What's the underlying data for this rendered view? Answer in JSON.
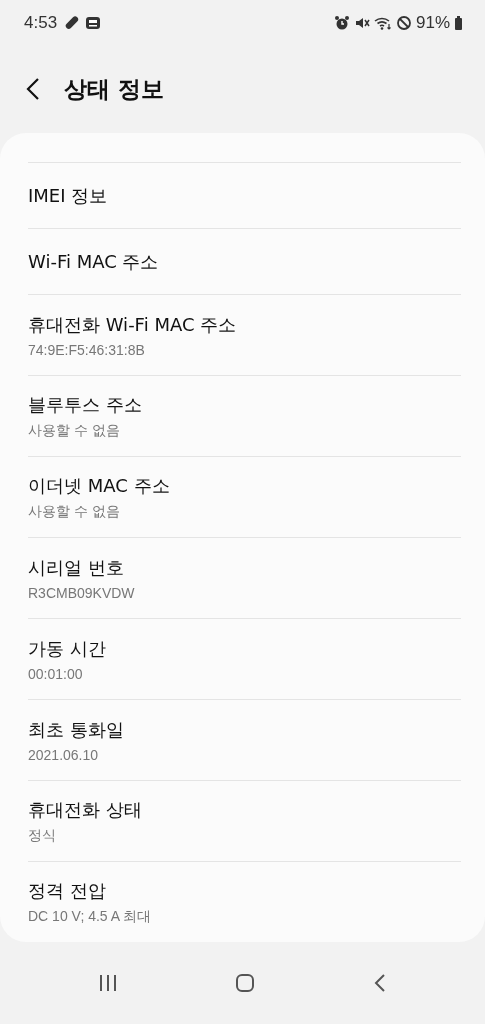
{
  "status_bar": {
    "time": "4:53",
    "battery": "91%"
  },
  "header": {
    "title": "상태 정보"
  },
  "items": [
    {
      "title": "IMEI 정보"
    },
    {
      "title": "Wi-Fi MAC 주소"
    },
    {
      "title": "휴대전화 Wi-Fi MAC 주소",
      "value": "74:9E:F5:46:31:8B"
    },
    {
      "title": "블루투스 주소",
      "value": "사용할 수 없음"
    },
    {
      "title": "이더넷 MAC 주소",
      "value": "사용할 수 없음"
    },
    {
      "title": "시리얼 번호",
      "value": "R3CMB09KVDW"
    },
    {
      "title": "가동 시간",
      "value": "00:01:00"
    },
    {
      "title": "최초 통화일",
      "value": "2021.06.10"
    },
    {
      "title": "휴대전화 상태",
      "value": "정식"
    },
    {
      "title": "정격 전압",
      "value": "DC 10 V; 4.5 A 최대"
    }
  ]
}
